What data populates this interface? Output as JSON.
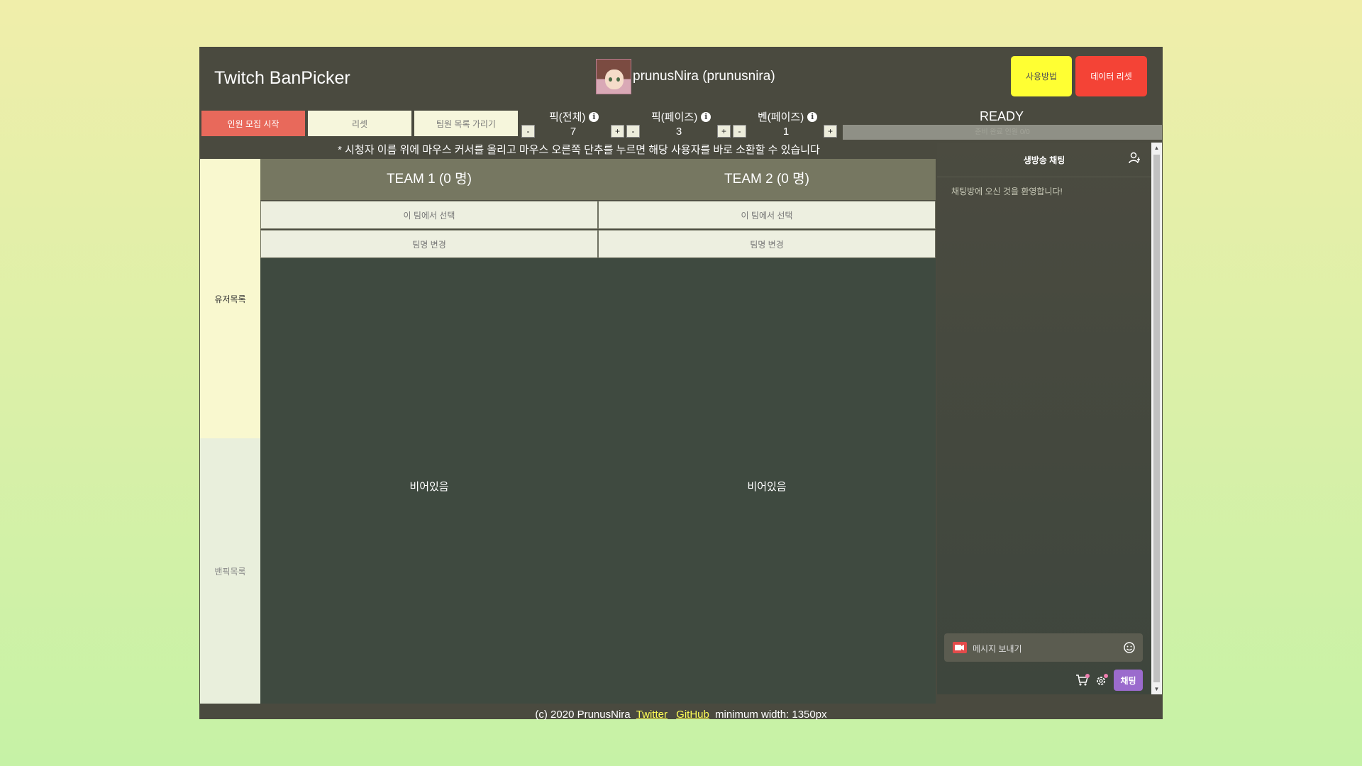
{
  "header": {
    "app_title": "Twitch BanPicker",
    "user_display": "prunusNira (prunusnira)",
    "help_label": "사용방법",
    "reset_data_label": "데이터 리셋"
  },
  "controls": {
    "start_label": "인원 모집 시작",
    "reset_label": "리셋",
    "hide_list_label": "팀원 목록 가리기",
    "pick_total": {
      "label": "픽(전체)",
      "value": "7"
    },
    "pick_phase": {
      "label": "픽(페이즈)",
      "value": "3"
    },
    "ban_phase": {
      "label": "벤(페이즈)",
      "value": "1"
    },
    "minus": "-",
    "plus": "+",
    "ready_label": "READY",
    "ready_bar_text": "준비 완료 인원 0/0"
  },
  "notice": "* 시청자 이름 위에 마우스 커서를 올리고 마우스 오른쪽 단추를 누르면 해당 사용자를 바로 소환할 수 있습니다",
  "sidebar": {
    "users_label": "유저목록",
    "banpick_label": "밴픽목록"
  },
  "teams": [
    {
      "title": "TEAM 1 (0 명)",
      "select_label": "이 팀에서 선택",
      "rename_label": "팀명 변경",
      "empty_label": "비어있음"
    },
    {
      "title": "TEAM 2 (0 명)",
      "select_label": "이 팀에서 선택",
      "rename_label": "팀명 변경",
      "empty_label": "비어있음"
    }
  ],
  "chat": {
    "title": "생방송 채팅",
    "welcome": "채팅방에 오신 것을 환영합니다!",
    "placeholder": "메시지 보내기",
    "send_label": "채팅"
  },
  "footer": {
    "copyright": "(c) 2020 PrunusNira",
    "twitter": "Twitter",
    "github": "GitHub",
    "min_width": "minimum width: 1350px"
  },
  "colors": {
    "app_bg": "#4a4a3f",
    "start_btn": "#e8695b",
    "help_btn": "#ffff33",
    "reset_data_btn": "#f44336",
    "chat_send": "#9b6bcd"
  }
}
